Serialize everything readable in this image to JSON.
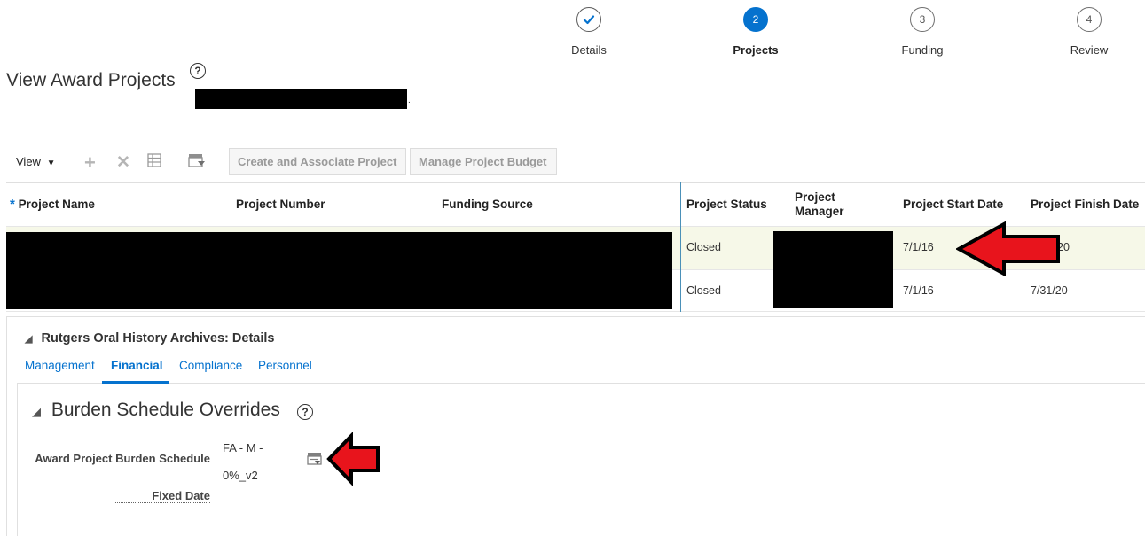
{
  "train": {
    "steps": [
      {
        "number": "",
        "label": "Details",
        "state": "done"
      },
      {
        "number": "2",
        "label": "Projects",
        "state": "current"
      },
      {
        "number": "3",
        "label": "Funding",
        "state": "pending"
      },
      {
        "number": "4",
        "label": "Review",
        "state": "pending"
      }
    ]
  },
  "page": {
    "title": "View Award Projects",
    "help_glyph": "?",
    "title_suffix": "."
  },
  "toolbar": {
    "view_label": "View",
    "create_associate_label": "Create and Associate Project",
    "manage_budget_label": "Manage Project Budget"
  },
  "table": {
    "required_marker": "*",
    "headers": {
      "project_name": "Project Name",
      "project_number": "Project Number",
      "funding_source": "Funding Source",
      "project_status": "Project Status",
      "project_manager": "Project Manager",
      "start_date": "Project Start Date",
      "finish_date": "Project Finish Date"
    },
    "rows": [
      {
        "status": "Closed",
        "start_date": "7/1/16",
        "finish_date": "20"
      },
      {
        "status": "Closed",
        "start_date": "7/1/16",
        "finish_date": "7/31/20"
      }
    ]
  },
  "details": {
    "title": "Rutgers Oral History Archives: Details",
    "tabs": [
      "Management",
      "Financial",
      "Compliance",
      "Personnel"
    ],
    "active_tab": "Financial",
    "section_title": "Burden Schedule Overrides",
    "fields": {
      "burden_schedule_label": "Award Project Burden Schedule",
      "burden_schedule_value_line1": "FA - M -",
      "burden_schedule_value_line2": "0%_v2",
      "fixed_date_label": "Fixed Date"
    }
  },
  "colors": {
    "accent": "#0572ce",
    "selected_row": "#f6f8e8",
    "annotation_arrow": "#e8141c"
  }
}
